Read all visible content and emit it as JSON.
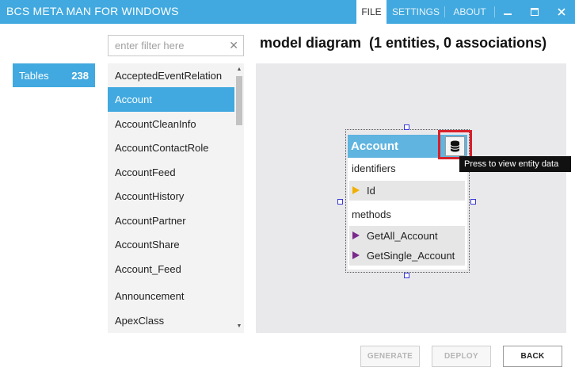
{
  "app": {
    "title": "BCS META MAN FOR WINDOWS"
  },
  "menu": {
    "file": "FILE",
    "settings": "SETTINGS",
    "about": "ABOUT"
  },
  "tables": {
    "label": "Tables",
    "count": "238"
  },
  "filter": {
    "placeholder": "enter filter here",
    "value": ""
  },
  "entity_list": {
    "items": [
      {
        "label": "AcceptedEventRelation",
        "selected": false
      },
      {
        "label": "Account",
        "selected": true
      },
      {
        "label": "AccountCleanInfo",
        "selected": false
      },
      {
        "label": "AccountContactRole",
        "selected": false
      },
      {
        "label": "AccountFeed",
        "selected": false
      },
      {
        "label": "AccountHistory",
        "selected": false
      },
      {
        "label": "AccountPartner",
        "selected": false
      },
      {
        "label": "AccountShare",
        "selected": false
      },
      {
        "label": "Account_Feed",
        "selected": false
      },
      {
        "label": "Announcement",
        "selected": false
      },
      {
        "label": "ApexClass",
        "selected": false
      }
    ]
  },
  "diagram": {
    "title": "model diagram  (1 entities, 0 associations)",
    "entity": {
      "name": "Account",
      "identifiers_label": "identifiers",
      "identifiers": [
        "Id"
      ],
      "methods_label": "methods",
      "methods": [
        "GetAll_Account",
        "GetSingle_Account"
      ]
    },
    "tooltip": "Press to view entity data"
  },
  "buttons": {
    "generate": "GENERATE",
    "deploy": "DEPLOY",
    "back": "BACK"
  },
  "colors": {
    "accent": "#41a9df",
    "entity_header": "#5fb4e0",
    "highlight": "#d8202a",
    "identifier_marker": "#f0b000",
    "method_marker": "#7a2a8a"
  }
}
